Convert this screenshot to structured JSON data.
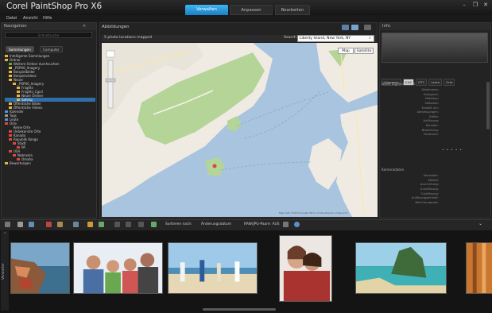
{
  "app": {
    "title": "Corel PaintShop Pro X6"
  },
  "tabs": [
    "Verwalten",
    "Anpassen",
    "Bearbeiten"
  ],
  "window_controls": {
    "minimize": "–",
    "restore": "❐",
    "close": "✕"
  },
  "menu": [
    "Datei",
    "Ansicht",
    "Hilfe"
  ],
  "nav": {
    "title": "Navigation",
    "search_placeholder": "Schnellsuche",
    "tabs": [
      "Sammlungen",
      "Computer"
    ],
    "tree": [
      {
        "label": "Intelligente Sammlungen",
        "indent": 0,
        "icon": "yellow"
      },
      {
        "label": "Ordner",
        "indent": 0,
        "icon": "yellow"
      },
      {
        "label": "Weitere Ordner durchsuchen",
        "indent": 1,
        "icon": "green"
      },
      {
        "label": "_PSPX6_Imagery",
        "indent": 1,
        "icon": "yellow"
      },
      {
        "label": "Beispielbilder",
        "indent": 1,
        "icon": "yellow"
      },
      {
        "label": "Beispielvideos",
        "indent": 1,
        "icon": "yellow"
      },
      {
        "label": "Neuer",
        "indent": 1,
        "icon": "yellow"
      },
      {
        "label": "_PSPX6_Imagery",
        "indent": 2,
        "icon": "yellow"
      },
      {
        "label": "Fnights",
        "indent": 3,
        "icon": "yellow"
      },
      {
        "label": "Fnights_Cgcd",
        "indent": 3,
        "icon": "yellow"
      },
      {
        "label": "Neuer Ordner",
        "indent": 3,
        "icon": "yellow"
      },
      {
        "label": "Sahmp",
        "indent": 3,
        "icon": "yellow",
        "selected": true
      },
      {
        "label": "Öffentliche Bilder",
        "indent": 1,
        "icon": "yellow"
      },
      {
        "label": "Öffentliche Videos",
        "indent": 1,
        "icon": "yellow"
      },
      {
        "label": "Kalender",
        "indent": 0,
        "icon": "blue"
      },
      {
        "label": "Tags",
        "indent": 0,
        "icon": "grey"
      },
      {
        "label": "Leute",
        "indent": 0,
        "icon": "blue"
      },
      {
        "label": "Orte",
        "indent": 0,
        "icon": "red"
      },
      {
        "label": "Keine Orte",
        "indent": 1,
        "icon": "none"
      },
      {
        "label": "Unbekannte Orte",
        "indent": 1,
        "icon": "red"
      },
      {
        "label": "Kanada",
        "indent": 1,
        "icon": "red"
      },
      {
        "label": "Republik Kongo",
        "indent": 1,
        "icon": "red"
      },
      {
        "label": "Stadt",
        "indent": 2,
        "icon": "red"
      },
      {
        "label": "PA",
        "indent": 3,
        "icon": "red"
      },
      {
        "label": "USA",
        "indent": 1,
        "icon": "red"
      },
      {
        "label": "Nebraska",
        "indent": 2,
        "icon": "red"
      },
      {
        "label": "Omaha",
        "indent": 3,
        "icon": "red"
      },
      {
        "label": "Bewertungen",
        "indent": 0,
        "icon": "star"
      }
    ]
  },
  "map_panel": {
    "title": "Abbildungen",
    "count_text": "5 photo locations mapped",
    "search_label": "Search",
    "search_value": "Liberty Island, New York, NY",
    "map_btn": "Map",
    "satellite_btn": "Satellite",
    "footer": "Map data ©2013 Google  Terms of Use  Report a map error"
  },
  "info": {
    "title": "Info",
    "tabs": [
      "Allgemein",
      "EXIF",
      "IPTC",
      "Leute",
      "Orte"
    ],
    "section1": "Datei-Eigenschaften",
    "fields1": [
      "Dateiname:",
      "Kategorie:",
      "Dateityp:",
      "Software:",
      "Erstellt um:",
      "Abmessungen:",
      "Größe:",
      "Auflösung:",
      "Künstler:",
      "Bewertung:",
      "Farbraum:"
    ],
    "rating": "• • • • •",
    "section2": "Kameradaten",
    "fields2": [
      "Hersteller:",
      "Modell:",
      "Ausrichtung:",
      "X-Auflösung:",
      "Y-Auflösung:",
      "Auflösungseinheit:",
      "Belichtungszeit:"
    ]
  },
  "toolbar": {
    "sort_label": "Sortieren nach:",
    "sort_value": "Änderungsdatum",
    "filter_value": "RAW/JPG-Paare: AUS"
  },
  "filmstrip": {
    "side_label": "Verwalter"
  },
  "colors": {
    "accent": "#1a7fc8",
    "water": "#a9c4df",
    "land": "#efebe3",
    "park": "#b5d497"
  }
}
